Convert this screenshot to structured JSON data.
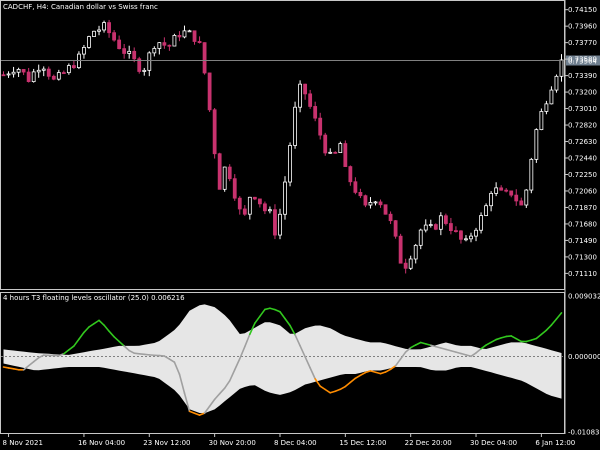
{
  "chart_title": "CADCHF, H4:  Canadian dollar vs Swiss franc",
  "indicator_label": "4 hours T3 floating levels oscillator (25.0) 0.006216",
  "current_price_label": "0.73564",
  "colors": {
    "background": "#000000",
    "frame": "#c8c8c8",
    "bull_candle": "#ffffff",
    "bear_candle": "#c8326e",
    "price_line": "#808080",
    "band_fill": "#e6e6e6",
    "osc_up": "#32c81e",
    "osc_down": "#ff8c00",
    "osc_neutral": "#a0a0a0",
    "price_tag_bg": "#708090"
  },
  "chart_data": [
    {
      "type": "candlestick",
      "title": "CADCHF, H4:  Canadian dollar vs Swiss franc",
      "ylim": [
        0.7093,
        0.7425
      ],
      "y_ticks": [
        "0.74150",
        "0.73960",
        "0.73770",
        "0.73580",
        "0.73390",
        "0.73200",
        "0.73010",
        "0.72820",
        "0.72630",
        "0.72440",
        "0.72250",
        "0.72060",
        "0.71870",
        "0.71680",
        "0.71490",
        "0.71300",
        "0.71110"
      ],
      "current_price": 0.73564,
      "close_path": [
        [
          0,
          0.734
        ],
        [
          2,
          0.735
        ],
        [
          4,
          0.7335
        ],
        [
          6,
          0.7355
        ],
        [
          8,
          0.7332
        ],
        [
          10,
          0.7345
        ],
        [
          12,
          0.736
        ],
        [
          14,
          0.739
        ],
        [
          16,
          0.7395
        ],
        [
          18,
          0.7375
        ],
        [
          20,
          0.736
        ],
        [
          22,
          0.7345
        ],
        [
          24,
          0.738
        ],
        [
          26,
          0.7372
        ],
        [
          28,
          0.739
        ],
        [
          30,
          0.7385
        ],
        [
          31,
          0.7372
        ],
        [
          32,
          0.733
        ],
        [
          33,
          0.727
        ],
        [
          34,
          0.721
        ],
        [
          35,
          0.7235
        ],
        [
          36,
          0.722
        ],
        [
          37,
          0.7185
        ],
        [
          38,
          0.7175
        ],
        [
          39,
          0.7205
        ],
        [
          40,
          0.72
        ],
        [
          41,
          0.7185
        ],
        [
          42,
          0.718
        ],
        [
          43,
          0.7155
        ],
        [
          44,
          0.7195
        ],
        [
          45,
          0.725
        ],
        [
          46,
          0.73
        ],
        [
          47,
          0.733
        ],
        [
          48,
          0.731
        ],
        [
          49,
          0.729
        ],
        [
          50,
          0.727
        ],
        [
          51,
          0.725
        ],
        [
          52,
          0.724
        ],
        [
          53,
          0.7265
        ],
        [
          54,
          0.7225
        ],
        [
          55,
          0.7215
        ],
        [
          56,
          0.72
        ],
        [
          57,
          0.7185
        ],
        [
          58,
          0.7195
        ],
        [
          59,
          0.72
        ],
        [
          60,
          0.7185
        ],
        [
          61,
          0.717
        ],
        [
          62,
          0.7145
        ],
        [
          63,
          0.7115
        ],
        [
          64,
          0.713
        ],
        [
          65,
          0.7145
        ],
        [
          66,
          0.7165
        ],
        [
          67,
          0.716
        ],
        [
          68,
          0.7165
        ],
        [
          69,
          0.7175
        ],
        [
          70,
          0.717
        ],
        [
          71,
          0.716
        ],
        [
          72,
          0.715
        ],
        [
          73,
          0.7145
        ],
        [
          74,
          0.716
        ],
        [
          75,
          0.717
        ],
        [
          76,
          0.7185
        ],
        [
          77,
          0.721
        ],
        [
          78,
          0.7205
        ],
        [
          79,
          0.72
        ],
        [
          80,
          0.7205
        ],
        [
          81,
          0.7195
        ],
        [
          82,
          0.7185
        ],
        [
          83,
          0.7235
        ],
        [
          84,
          0.7275
        ],
        [
          85,
          0.73
        ],
        [
          86,
          0.732
        ],
        [
          87,
          0.734
        ],
        [
          88,
          0.7355
        ]
      ]
    },
    {
      "type": "line",
      "title": "4 hours T3 floating levels oscillator (25.0) 0.006216",
      "ylim": [
        -0.01089,
        0.009032
      ],
      "y_ticks": [
        "0.009032",
        "0.000000",
        "-0.010839"
      ],
      "series_values": [
        [
          0,
          -0.0015
        ],
        [
          3,
          -0.002
        ],
        [
          6,
          0.0002
        ],
        [
          9,
          0.0001
        ],
        [
          11,
          0.0015
        ],
        [
          13,
          0.004
        ],
        [
          15,
          0.0052
        ],
        [
          17,
          0.003
        ],
        [
          20,
          0.0005
        ],
        [
          23,
          0.0002
        ],
        [
          25,
          0.0001
        ],
        [
          27,
          -0.001
        ],
        [
          28,
          -0.0045
        ],
        [
          29,
          -0.0078
        ],
        [
          31,
          -0.0085
        ],
        [
          33,
          -0.006
        ],
        [
          35,
          -0.004
        ],
        [
          37,
          0.0
        ],
        [
          39,
          0.0045
        ],
        [
          41,
          0.007
        ],
        [
          43,
          0.0065
        ],
        [
          45,
          0.004
        ],
        [
          47,
          0.0
        ],
        [
          49,
          -0.004
        ],
        [
          51,
          -0.0052
        ],
        [
          53,
          -0.0045
        ],
        [
          55,
          -0.003
        ],
        [
          57,
          -0.002
        ],
        [
          59,
          -0.0025
        ],
        [
          61,
          -0.0015
        ],
        [
          63,
          0.001
        ],
        [
          65,
          0.002
        ],
        [
          67,
          0.0015
        ],
        [
          69,
          0.001
        ],
        [
          71,
          0.0005
        ],
        [
          73,
          0.0
        ],
        [
          75,
          0.0015
        ],
        [
          77,
          0.0025
        ],
        [
          79,
          0.003
        ],
        [
          81,
          0.002
        ],
        [
          83,
          0.0025
        ],
        [
          85,
          0.004
        ],
        [
          87,
          0.0062
        ]
      ],
      "band_upper": [
        [
          0,
          0.001
        ],
        [
          5,
          0.0005
        ],
        [
          10,
          0.0002
        ],
        [
          15,
          0.001
        ],
        [
          18,
          0.0015
        ],
        [
          21,
          0.0015
        ],
        [
          24,
          0.002
        ],
        [
          27,
          0.004
        ],
        [
          29,
          0.0065
        ],
        [
          31,
          0.0075
        ],
        [
          33,
          0.007
        ],
        [
          35,
          0.0055
        ],
        [
          37,
          0.003
        ],
        [
          39,
          0.004
        ],
        [
          41,
          0.005
        ],
        [
          43,
          0.0045
        ],
        [
          45,
          0.003
        ],
        [
          47,
          0.004
        ],
        [
          49,
          0.0045
        ],
        [
          51,
          0.004
        ],
        [
          53,
          0.003
        ],
        [
          55,
          0.0025
        ],
        [
          57,
          0.002
        ],
        [
          59,
          0.002
        ],
        [
          61,
          0.0015
        ],
        [
          63,
          0.001
        ],
        [
          65,
          0.001
        ],
        [
          67,
          0.0015
        ],
        [
          69,
          0.002
        ],
        [
          71,
          0.0015
        ],
        [
          73,
          0.0015
        ],
        [
          75,
          0.001
        ],
        [
          77,
          0.0015
        ],
        [
          79,
          0.002
        ],
        [
          81,
          0.002
        ],
        [
          83,
          0.0015
        ],
        [
          85,
          0.001
        ],
        [
          87,
          0.0005
        ]
      ],
      "band_lower": [
        [
          0,
          -0.001
        ],
        [
          5,
          -0.002
        ],
        [
          10,
          -0.0015
        ],
        [
          15,
          -0.0015
        ],
        [
          18,
          -0.002
        ],
        [
          21,
          -0.0025
        ],
        [
          24,
          -0.003
        ],
        [
          27,
          -0.005
        ],
        [
          29,
          -0.0075
        ],
        [
          31,
          -0.0082
        ],
        [
          33,
          -0.0075
        ],
        [
          35,
          -0.006
        ],
        [
          37,
          -0.0045
        ],
        [
          39,
          -0.004
        ],
        [
          41,
          -0.005
        ],
        [
          43,
          -0.0055
        ],
        [
          45,
          -0.005
        ],
        [
          47,
          -0.004
        ],
        [
          49,
          -0.0035
        ],
        [
          51,
          -0.003
        ],
        [
          53,
          -0.0025
        ],
        [
          55,
          -0.0025
        ],
        [
          57,
          -0.002
        ],
        [
          59,
          -0.002
        ],
        [
          61,
          -0.0015
        ],
        [
          63,
          -0.0015
        ],
        [
          65,
          -0.0015
        ],
        [
          67,
          -0.002
        ],
        [
          69,
          -0.002
        ],
        [
          71,
          -0.0015
        ],
        [
          73,
          -0.0015
        ],
        [
          75,
          -0.002
        ],
        [
          77,
          -0.0025
        ],
        [
          79,
          -0.003
        ],
        [
          81,
          -0.0035
        ],
        [
          83,
          -0.0045
        ],
        [
          85,
          -0.0055
        ],
        [
          87,
          -0.006
        ]
      ]
    }
  ],
  "x_ticks": [
    {
      "label": "8 Nov 2021",
      "bar": 1
    },
    {
      "label": "16 Nov 04:00",
      "bar": 16
    },
    {
      "label": "23 Nov 12:00",
      "bar": 29
    },
    {
      "label": "30 Nov 20:00",
      "bar": 42
    },
    {
      "label": "8 Dec 04:00",
      "bar": 55
    },
    {
      "label": "15 Dec 12:00",
      "bar": 68
    },
    {
      "label": "22 Dec 20:00",
      "bar": 81
    },
    {
      "label": "30 Dec 04:00",
      "bar": 94
    },
    {
      "label": "6 Jan 12:00",
      "bar": 107
    }
  ]
}
